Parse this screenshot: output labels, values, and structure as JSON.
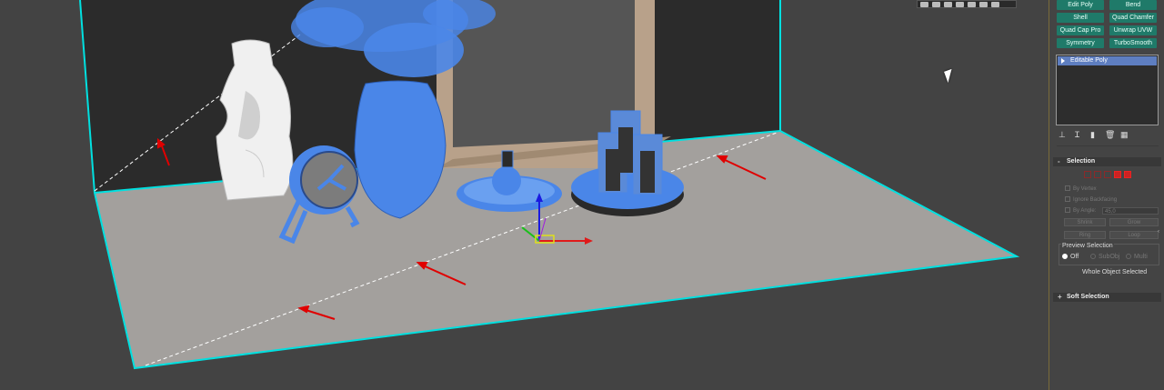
{
  "viewport": {
    "toolbar": {
      "buttons": 7
    },
    "accent_wire": "#00e0e0",
    "selected_color": "#4a86e8",
    "unselected_wire": "#ffffff",
    "annotation_color": "#e00000"
  },
  "modifiers": {
    "buttons": [
      "Edit Poly",
      "Bend",
      "Shell",
      "Quad Chamfer",
      "Quad Cap Pro",
      "Unwrap UVW",
      "Symmetry",
      "TurboSmooth"
    ],
    "accent": "#1f7a69"
  },
  "stack": {
    "items": [
      "Editable Poly"
    ],
    "icons": [
      "pin-stack-icon",
      "show-end-result-icon",
      "make-unique-icon",
      "remove-modifier-icon",
      "configure-modifier-sets-icon"
    ]
  },
  "selection": {
    "title": "Selection",
    "sign": "-",
    "levels": [
      "vertex",
      "edge",
      "border",
      "polygon",
      "element"
    ],
    "active_level": "polygon",
    "by_vertex": "By Vertex",
    "ignore_backfacing": "Ignore Backfacing",
    "by_angle": "By Angle:",
    "angle_value": "45,0",
    "shrink": "Shrink",
    "grow": "Grow",
    "ring": "Ring",
    "loop": "Loop",
    "preview_label": "Preview Selection",
    "preview_options": [
      "Off",
      "SubObj",
      "Multi"
    ],
    "preview_selected": "Off",
    "status": "Whole Object Selected"
  },
  "soft_selection": {
    "title": "Soft Selection",
    "sign": "+"
  }
}
